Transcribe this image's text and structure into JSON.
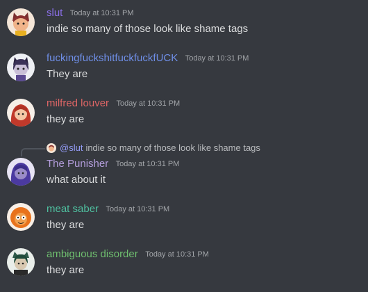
{
  "messages": [
    {
      "username": "slut",
      "username_color": "#8b6fe8",
      "timestamp": "Today at 10:31 PM",
      "content": "indie so many of those look like shame tags",
      "avatar_icon": "cat-girl-avatar"
    },
    {
      "username": "fuckingfuckshitfuckfuckfUCK",
      "username_color": "#6f8fe8",
      "timestamp": "Today at 10:31 PM",
      "content": "They are",
      "avatar_icon": "dark-hair-girl-avatar"
    },
    {
      "username": "milfred louver",
      "username_color": "#e06666",
      "timestamp": "Today at 10:31 PM",
      "content": "they are",
      "avatar_icon": "red-hair-woman-avatar"
    },
    {
      "reply": {
        "mention": "@slut",
        "text": "indie so many of those look like shame tags"
      },
      "username": "The Punisher",
      "username_color": "#b39ddb",
      "timestamp": "Today at 10:31 PM",
      "content": "what about it",
      "avatar_icon": "purple-hair-avatar"
    },
    {
      "username": "meat saber",
      "username_color": "#4fc0a0",
      "timestamp": "Today at 10:31 PM",
      "content": "they are",
      "avatar_icon": "orange-creature-avatar"
    },
    {
      "username": "ambiguous disorder",
      "username_color": "#6fbf6f",
      "timestamp": "Today at 10:31 PM",
      "content": "they are",
      "avatar_icon": "green-hair-avatar"
    }
  ]
}
